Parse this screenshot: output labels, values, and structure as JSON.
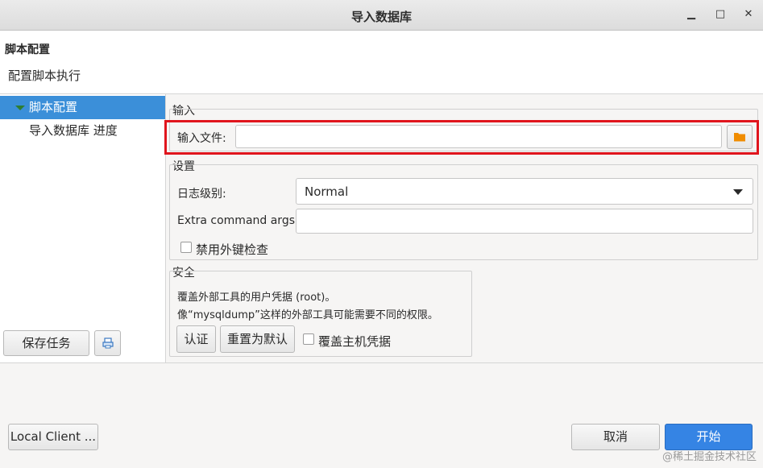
{
  "window": {
    "title": "导入数据库",
    "minimize_glyph": "▁",
    "maximize_glyph": "□",
    "close_glyph": "✕"
  },
  "header": {
    "title": "脚本配置",
    "subtitle": "配置脚本执行"
  },
  "sidebar": {
    "items": [
      {
        "label": "脚本配置",
        "selected": true
      },
      {
        "label": "导入数据库 进度",
        "selected": false
      }
    ],
    "save_task_label": "保存任务",
    "print_icon": "printer-icon"
  },
  "input_section": {
    "label": "输入",
    "file_label": "输入文件:",
    "file_value": "",
    "folder_icon": "folder-icon",
    "folder_color": "#f08c00"
  },
  "settings_section": {
    "label": "设置",
    "log_level_label": "日志级别:",
    "log_level_value": "Normal",
    "extra_args_label": "Extra command args:",
    "extra_args_value": "",
    "disable_fk_label": "禁用外键检查",
    "disable_fk_checked": false
  },
  "security_section": {
    "label": "安全",
    "line1": "覆盖外部工具的用户凭据 (root)。",
    "line2": "像“mysqldump”这样的外部工具可能需要不同的权限。",
    "auth_label": "认证",
    "reset_label": "重置为默认",
    "override_label": "覆盖主机凭据",
    "override_checked": false
  },
  "footer": {
    "local_client_label": "Local Client ...",
    "cancel_label": "取消",
    "start_label": "开始",
    "start_color": "#3584e4"
  },
  "watermark": "@稀土掘金技术社区",
  "highlight_color": "#e0151d"
}
